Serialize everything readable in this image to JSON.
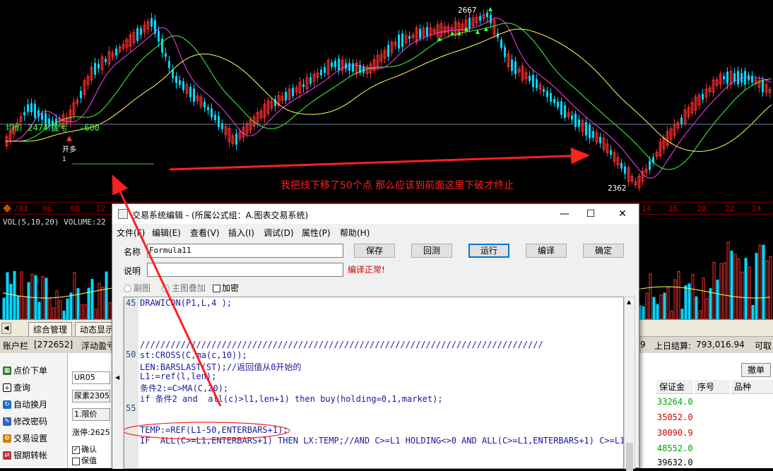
{
  "chart": {
    "price_labels": {
      "high": "2667",
      "low": "2362"
    },
    "avg_line": {
      "label": "均价 2474",
      "pnl_label": "盈亏",
      "pnl": "-600"
    },
    "entry_marker": {
      "label": "开多",
      "count": "1"
    },
    "annotation": "我把线下移了50个点  那么应该到前面这里下破才终止",
    "date_axis": [
      "/01",
      "06",
      "08",
      "12",
      "14",
      "16",
      "20",
      "22",
      "24"
    ],
    "volume_title": "VOL(5,10,20) VOLUME:22",
    "colors": {
      "up": "#ff3030",
      "down": "#00d8ff",
      "ma5": "#ff40ff",
      "ma10": "#40ff40",
      "ma20": "#ffff60",
      "annotation": "#ff2020"
    }
  },
  "tabs": {
    "items": [
      "综合管理",
      "动态显示"
    ]
  },
  "account_bar": {
    "label": "账户栏",
    "account": "[272652]",
    "float": "浮动盈亏",
    "digit": "9",
    "settle_label": "上日结算:",
    "settle_value": "793,016.94",
    "available": "可取"
  },
  "left_panel": {
    "items": [
      {
        "label": "点价下单",
        "icon": "grid-icon"
      },
      {
        "label": "查询",
        "icon": "plus-box-icon"
      },
      {
        "label": "自动换月",
        "icon": "refresh-icon"
      },
      {
        "label": "修改密码",
        "icon": "pencil-icon"
      },
      {
        "label": "交易设置",
        "icon": "gear-icon"
      },
      {
        "label": "银期转帐",
        "icon": "transfer-icon"
      }
    ]
  },
  "order_panel": {
    "contract": "UR05",
    "name": "尿素2305",
    "order_type": "1.限价",
    "limit_up": "涨停:2625",
    "confirm": "确认",
    "protect": "保值"
  },
  "right_table": {
    "withdraw": "撤单",
    "headers": {
      "margin": "保证金",
      "seq": "序号",
      "product": "品种"
    },
    "margin_values": [
      "33264.0",
      "35052.0",
      "30090.9",
      "48552.0",
      "39632.0"
    ],
    "margin_colors": [
      "#00a000",
      "#d00000",
      "#d00000",
      "#00a000",
      "#000000"
    ]
  },
  "dialog": {
    "title": "交易系统编辑 - (所属公式组：A.图表交易系统)",
    "menu": [
      "文件(F)",
      "编辑(E)",
      "查看(V)",
      "插入(I)",
      "调试(D)",
      "属性(P)",
      "帮助(H)"
    ],
    "name_label": "名称",
    "name_value": "Formula11",
    "desc_label": "说明",
    "desc_value": "",
    "compile_status": "编译正常!",
    "buttons": {
      "save": "保存",
      "backtest": "回测",
      "run": "运行",
      "compile": "编译",
      "ok": "确定"
    },
    "options": {
      "sub": "副图",
      "main": "主图叠加",
      "encrypt": "加密"
    },
    "gutter": [
      "45",
      "50",
      "55"
    ],
    "code": [
      "DRAWICON(P1,L,4 );",
      "",
      "",
      "",
      "///////////////////////////////////////////////////////////////////////////////",
      "st:CROSS(C,ma(c,10));",
      "LEN:BARSLAST(ST);//返回值从0开始的",
      "L1:=ref(l,len);",
      "条件2:=C>MA(C,20);",
      "if 条件2 and  all(c)>l1,len+1) then buy(holding=0,1,market);",
      "",
      "",
      "TEMP:=REF(L1-50,ENTERBARS+1);",
      "IF  ALL(C>=L1,ENTERBARS+1) THEN LX:TEMP;//AND C>=L1 HOLDING<>0 AND ALL(C>=L1,ENTERBARS+1) C>=L1"
    ]
  }
}
